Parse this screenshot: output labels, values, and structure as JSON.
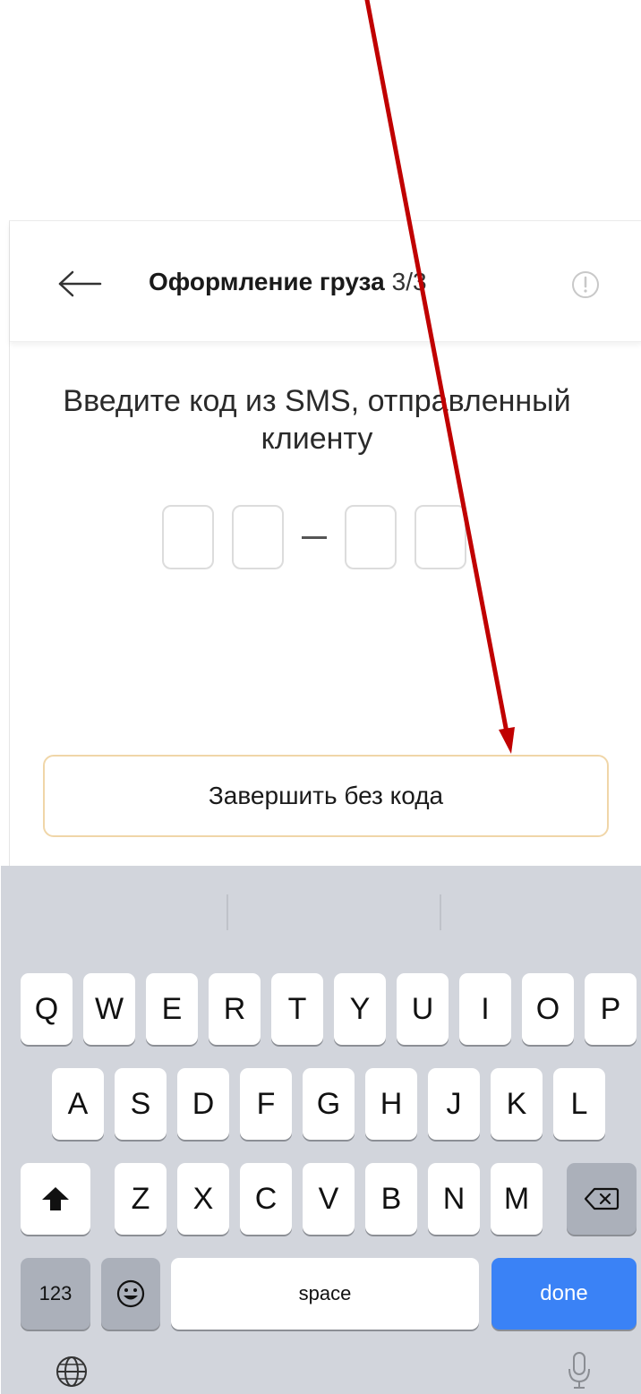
{
  "header": {
    "back_icon": "arrow-left-icon",
    "title": "Оформление груза",
    "step": "3/3",
    "info_icon": "info-circle-icon"
  },
  "prompt": {
    "line1": "Введите код из SMS, отправленный",
    "line2": "клиенту"
  },
  "code": {
    "digits": [
      "",
      "",
      "",
      ""
    ],
    "separator": "–"
  },
  "finish_button": {
    "label": "Завершить без кода",
    "border_color": "#f0d6a8"
  },
  "keyboard": {
    "row1": [
      "Q",
      "W",
      "E",
      "R",
      "T",
      "Y",
      "U",
      "I",
      "O",
      "P"
    ],
    "row2": [
      "A",
      "S",
      "D",
      "F",
      "G",
      "H",
      "J",
      "K",
      "L"
    ],
    "row3": [
      "Z",
      "X",
      "C",
      "V",
      "B",
      "N",
      "M"
    ],
    "shift_icon": "shift-icon",
    "backspace_icon": "backspace-icon",
    "numbers_label": "123",
    "emoji_icon": "emoji-icon",
    "space_label": "space",
    "done_label": "done",
    "globe_icon": "globe-icon",
    "mic_icon": "microphone-icon",
    "done_color": "#3a82f6"
  },
  "annotation": {
    "arrow_color": "#c00000"
  }
}
